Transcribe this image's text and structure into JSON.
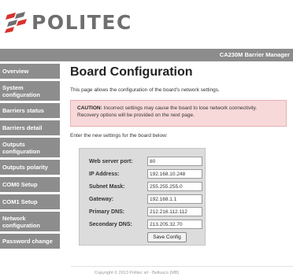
{
  "header": {
    "logo_text": "POLITEC",
    "banner_title": "CA230M Barrier Manager"
  },
  "sidebar": {
    "items": [
      {
        "label": "Overview"
      },
      {
        "label": "System configuration"
      },
      {
        "label": "Barriers status"
      },
      {
        "label": "Barriers detail"
      },
      {
        "label": "Outputs configuration"
      },
      {
        "label": "Outputs polarity"
      },
      {
        "label": "COM0 Setup"
      },
      {
        "label": "COM1 Setup"
      },
      {
        "label": "Network configuration"
      },
      {
        "label": "Password change"
      }
    ]
  },
  "main": {
    "title": "Board Configuration",
    "intro": "This page allows the configuration of the board's network settings.",
    "caution_label": "CAUTION:",
    "caution_text": "Incorrect settings may cause the board to lose network connectivity. Recovery options will be provided on the next page.",
    "enter_text": "Enter the new settings for the board below:"
  },
  "form": {
    "fields": [
      {
        "label": "Web server port:",
        "value": "80"
      },
      {
        "label": "IP Address:",
        "value": "192.168.10.248"
      },
      {
        "label": "Subnet Mask:",
        "value": "255.255.255.0"
      },
      {
        "label": "Gateway:",
        "value": "192.168.1.1"
      },
      {
        "label": "Primary DNS:",
        "value": "212.216.112.112"
      },
      {
        "label": "Secondary DNS:",
        "value": "213.205.32.70"
      }
    ],
    "save_label": "Save Config"
  },
  "footer": {
    "copyright": "Copyright © 2013 Politec srl - Bellusco (MB)"
  },
  "colors": {
    "sidebar_bg": "#8d8d8d",
    "banner_bg": "#8c8c8c",
    "caution_bg": "#f8d9d9",
    "form_bg": "#dcdcdc",
    "logo_red": "#d9322e",
    "logo_gray": "#6f6f6f"
  }
}
